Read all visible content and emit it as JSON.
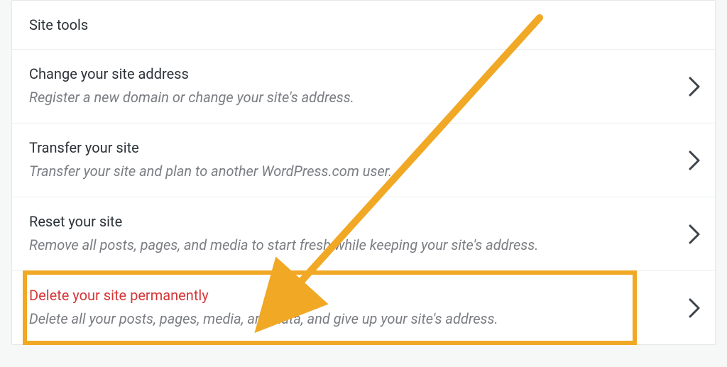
{
  "header": {
    "title": "Site tools"
  },
  "rows": [
    {
      "title": "Change your site address",
      "desc": "Register a new domain or change your site's address."
    },
    {
      "title": "Transfer your site",
      "desc": "Transfer your site and plan to another WordPress.com user."
    },
    {
      "title": "Reset your site",
      "desc": "Remove all posts, pages, and media to start fresh while keeping your site's address."
    },
    {
      "title": "Delete your site permanently",
      "desc": "Delete all your posts, pages, media, and data, and give up your site's address."
    }
  ],
  "annotation": {
    "highlight_color": "#f0a825"
  }
}
